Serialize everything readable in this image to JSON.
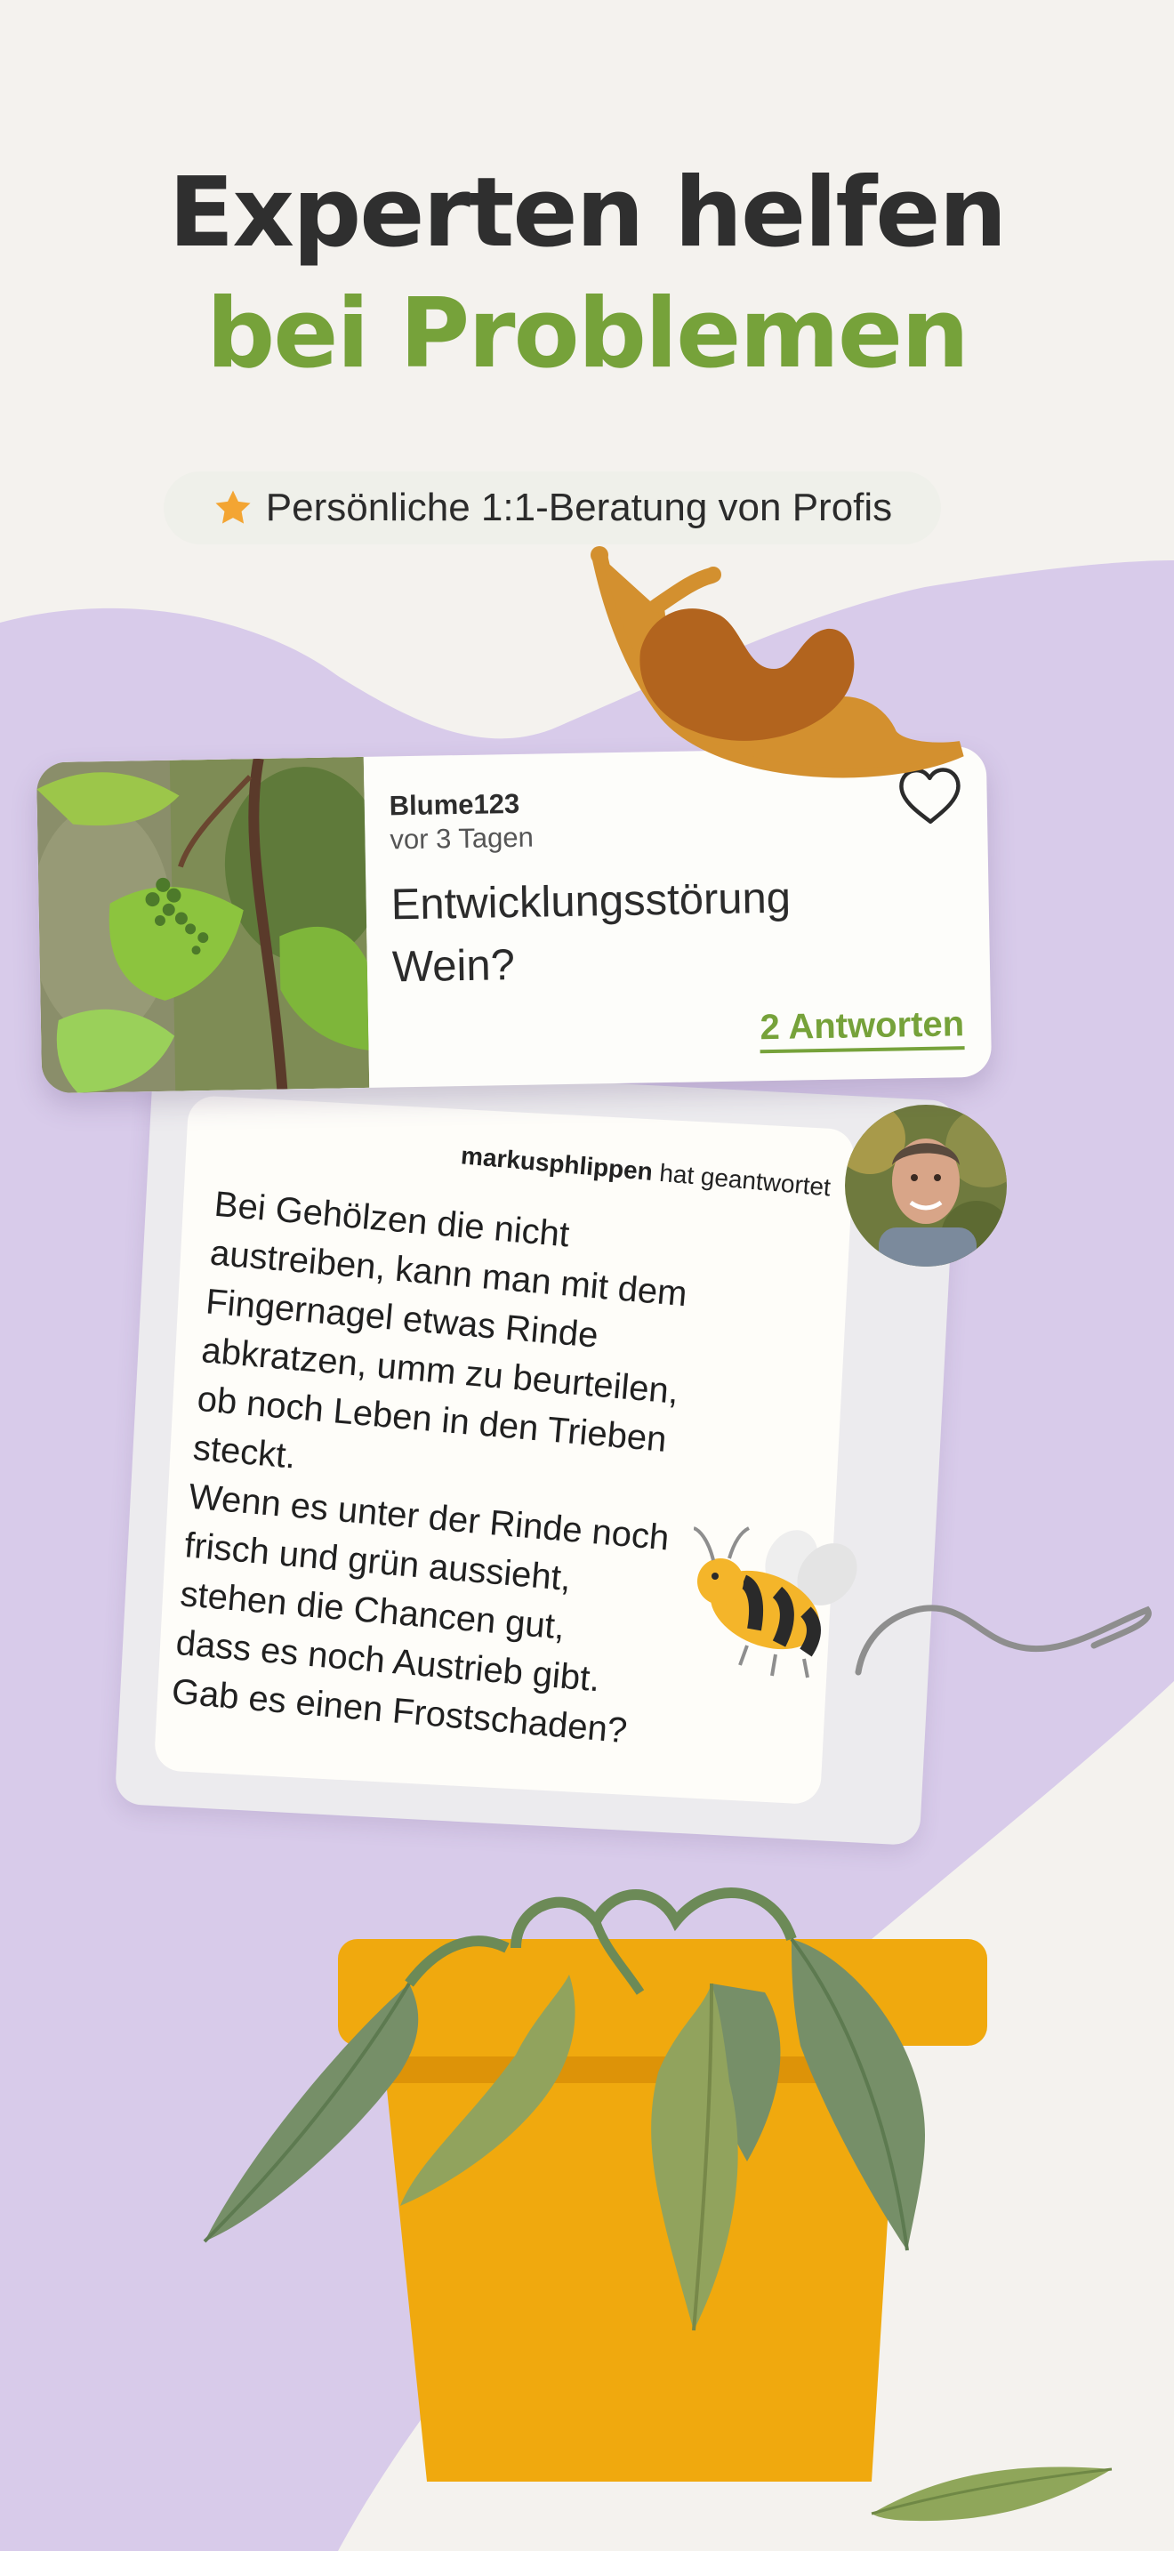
{
  "headline": {
    "line1": "Experten helfen",
    "line2": "bei Problemen"
  },
  "pill": {
    "label": "Persönliche 1:1-Beratung von Profis",
    "icon": "star-icon"
  },
  "question": {
    "user": "Blume123",
    "time": "vor 3 Tagen",
    "title": "Entwicklungsstörung Wein?",
    "answers_label": "2 Antworten",
    "image": "grapevine-photo",
    "like_icon": "heart-icon"
  },
  "answer": {
    "author": "markusphlippen",
    "action": "hat geantwortet",
    "text": "Bei Gehölzen die nicht\naustreiben, kann man mit dem\nFingernagel etwas Rinde\nabkratzen, umm zu beurteilen,\nob noch Leben in den Trieben\nsteckt.\nWenn es unter der Rinde noch\nfrisch und grün aussieht,\nstehen die Chancen gut,\ndass es noch Austrieb gibt.\nGab es einen Frostschaden?",
    "avatar": "expert-avatar"
  },
  "colors": {
    "accent_green": "#76a23a",
    "headline_dark": "#2f2f2f",
    "lavender": "#d8cbea",
    "background": "#f4f2ee",
    "pot_orange": "#f0a90e"
  }
}
